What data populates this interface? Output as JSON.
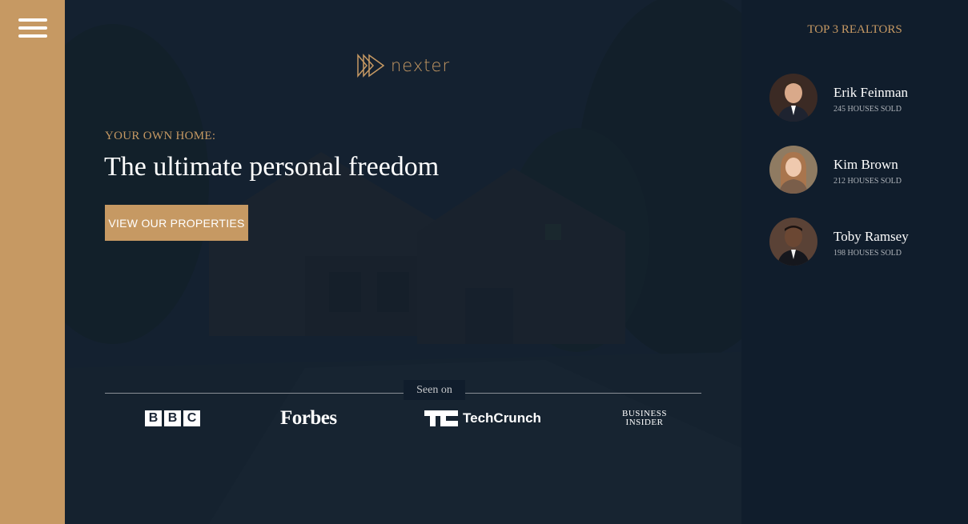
{
  "sidebar": {
    "menu_icon": "hamburger-menu-icon"
  },
  "hero": {
    "logo_icon": "nexter-logo-icon",
    "logo_text": "nexter",
    "pretitle": "YOUR OWN HOME:",
    "title": "The ultimate personal freedom",
    "button_label": "VIEW OUR PROPERTIES",
    "seen_on": "Seen on",
    "brands": {
      "bbc": [
        "B",
        "B",
        "C"
      ],
      "forbes": "Forbes",
      "techcrunch": "TechCrunch",
      "business_insider_line1": "BUSINESS",
      "business_insider_line2": "INSIDER"
    }
  },
  "realtors": {
    "title": "TOP 3 REALTORS",
    "items": [
      {
        "name": "Erik Feinman",
        "sold": "245 HOUSES SOLD"
      },
      {
        "name": "Kim Brown",
        "sold": "212 HOUSES SOLD"
      },
      {
        "name": "Toby Ramsey",
        "sold": "198 HOUSES SOLD"
      }
    ]
  },
  "colors": {
    "accent": "#c69963",
    "dark": "#101d2c",
    "white": "#ffffff"
  }
}
